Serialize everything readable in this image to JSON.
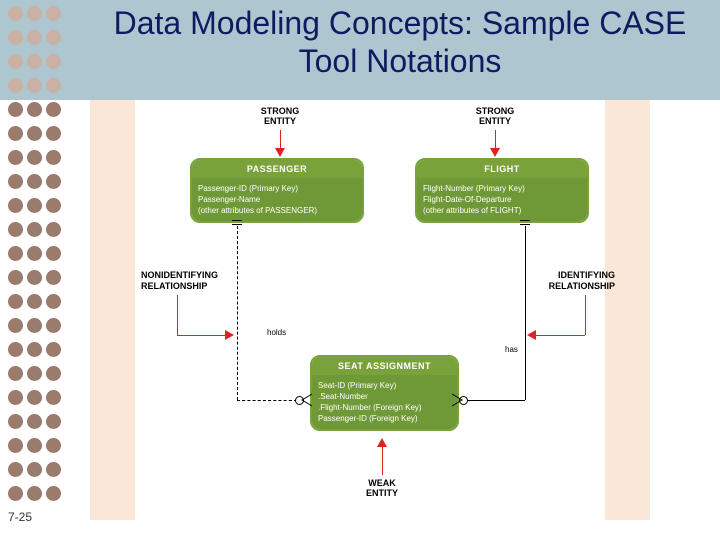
{
  "title": "Data Modeling Concepts: Sample CASE Tool Notations",
  "pageNumber": "7-25",
  "labels": {
    "strongLeft": "STRONG\nENTITY",
    "strongRight": "STRONG\nENTITY",
    "weak": "WEAK\nENTITY",
    "nonIdent": "NONIDENTIFYING\nRELATIONSHIP",
    "ident": "IDENTIFYING\nRELATIONSHIP"
  },
  "relations": {
    "holds": "holds",
    "has": "has"
  },
  "entities": {
    "passenger": {
      "name": "PASSENGER",
      "attrs": [
        "Passenger-ID (Primary Key)",
        "Passenger-Name",
        "(other attributes of PASSENGER)"
      ]
    },
    "flight": {
      "name": "FLIGHT",
      "attrs": [
        "Flight-Number (Primary Key)",
        "Flight-Date-Of-Departure",
        "(other attributes of FLIGHT)"
      ]
    },
    "seat": {
      "name": "SEAT ASSIGNMENT",
      "attrs": [
        "Seat-ID (Primary Key)",
        ".Seat-Number",
        ".Flight-Number (Foreign Key)",
        "Passenger-ID (Foreign Key)"
      ]
    }
  }
}
